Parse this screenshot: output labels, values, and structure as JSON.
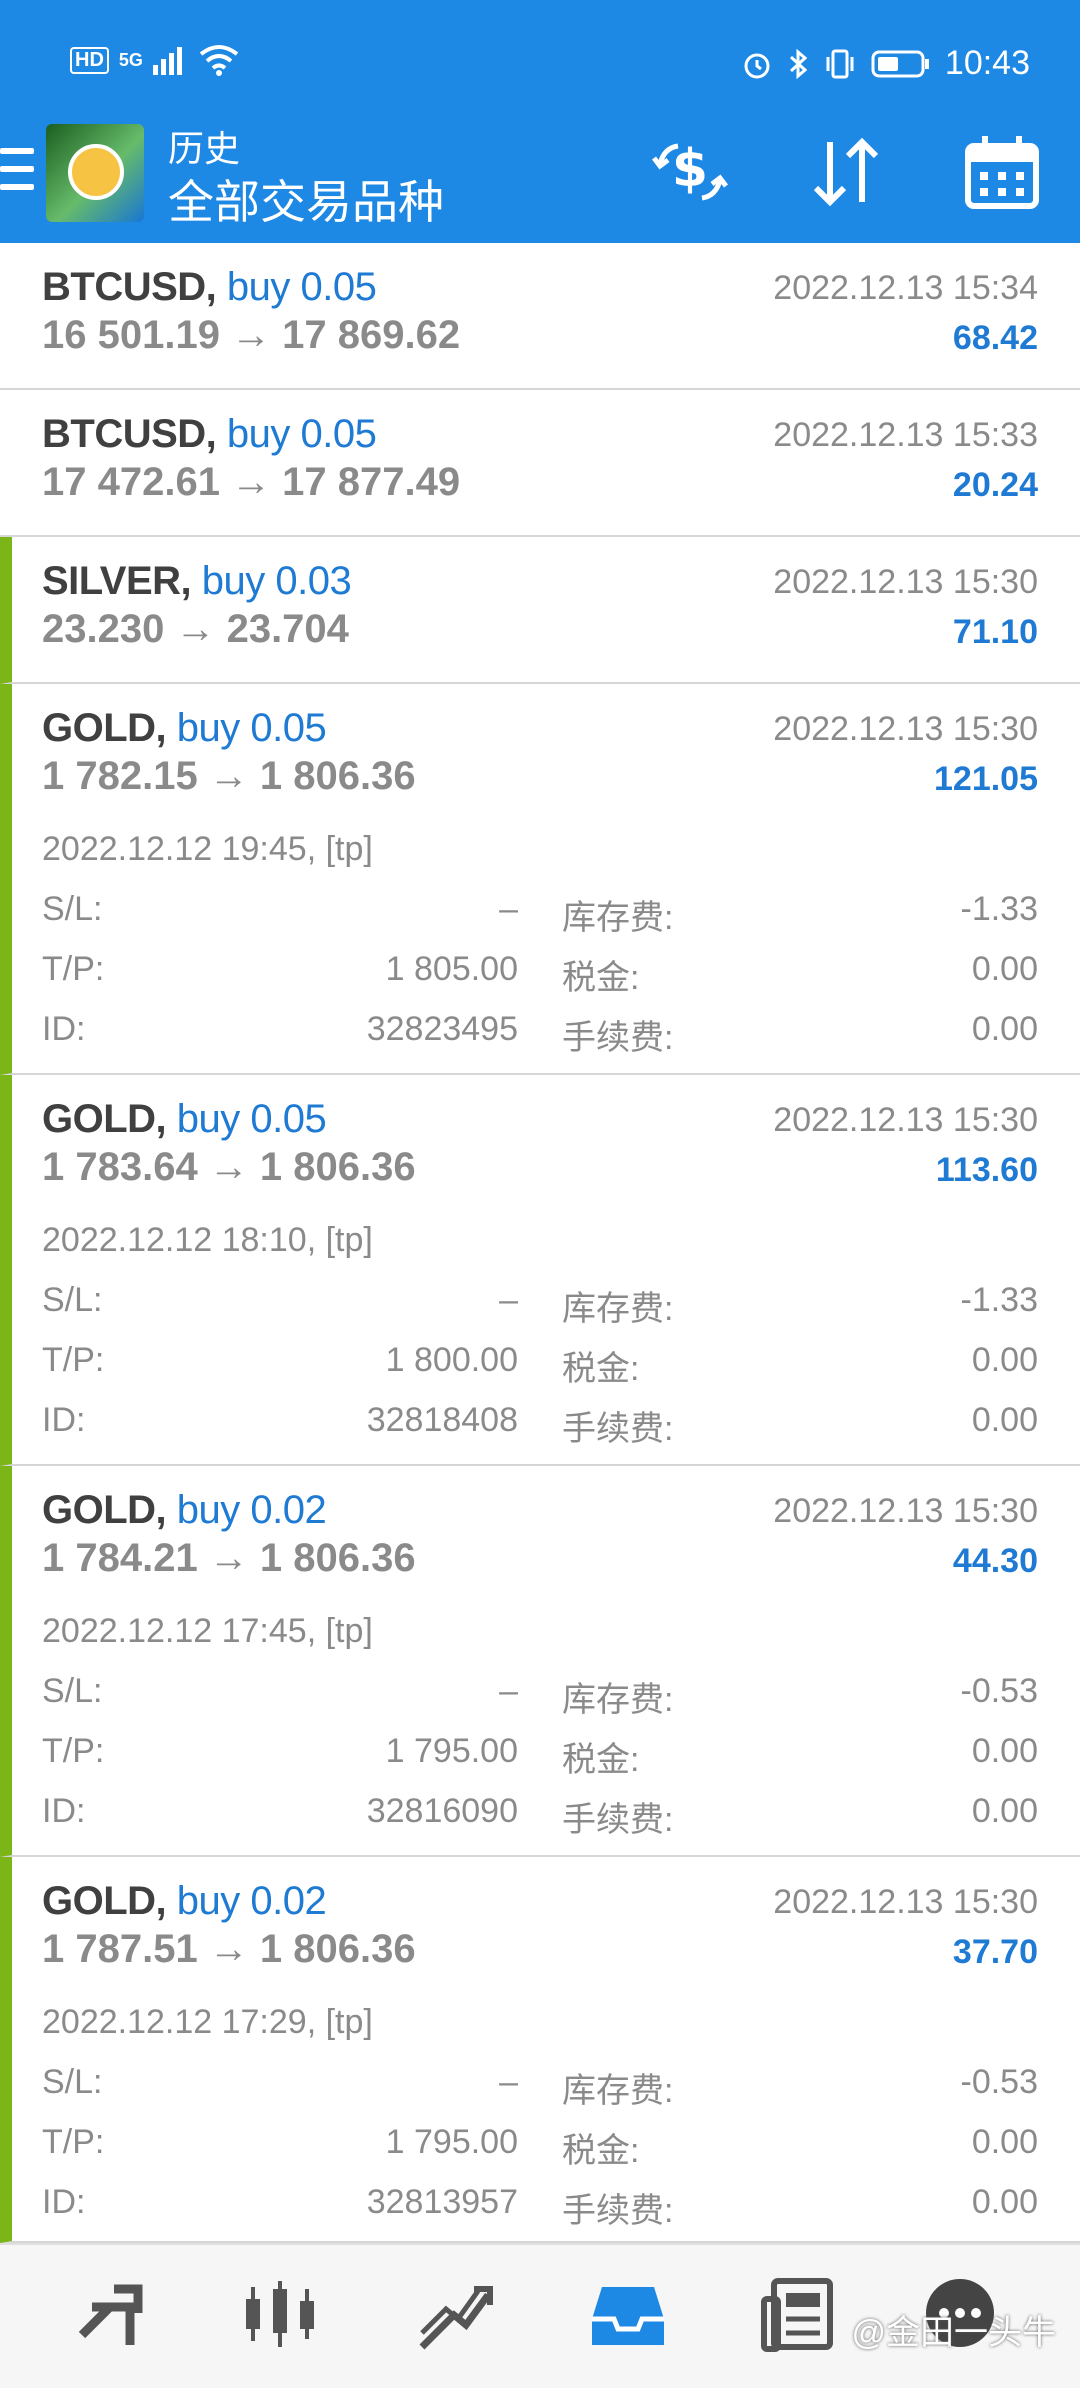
{
  "status": {
    "time": "10:43",
    "signal_hd": "HD",
    "signal_5g": "5G"
  },
  "header": {
    "subtitle": "历史",
    "title": "全部交易品种"
  },
  "trades": [
    {
      "symbol": "BTCUSD,",
      "side": "buy 0.05",
      "close_time": "2022.12.13 15:34",
      "prices": "16 501.19 → 17 869.62",
      "profit": "68.42",
      "green": false,
      "expanded": false
    },
    {
      "symbol": "BTCUSD,",
      "side": "buy 0.05",
      "close_time": "2022.12.13 15:33",
      "prices": "17 472.61 → 17 877.49",
      "profit": "20.24",
      "green": false,
      "expanded": false
    },
    {
      "symbol": "SILVER,",
      "side": "buy 0.03",
      "close_time": "2022.12.13 15:30",
      "prices": "23.230 → 23.704",
      "profit": "71.10",
      "green": true,
      "expanded": false
    },
    {
      "symbol": "GOLD,",
      "side": "buy 0.05",
      "close_time": "2022.12.13 15:30",
      "prices": "1 782.15 → 1 806.36",
      "profit": "121.05",
      "green": true,
      "expanded": true,
      "open_time": "2022.12.12 19:45, [tp]",
      "sl_label": "S/L:",
      "sl": "–",
      "tp_label": "T/P:",
      "tp": "1 805.00",
      "id_label": "ID:",
      "id": "32823495",
      "swap_label": "库存费:",
      "swap": "-1.33",
      "tax_label": "税金:",
      "tax": "0.00",
      "fee_label": "手续费:",
      "fee": "0.00"
    },
    {
      "symbol": "GOLD,",
      "side": "buy 0.05",
      "close_time": "2022.12.13 15:30",
      "prices": "1 783.64 → 1 806.36",
      "profit": "113.60",
      "green": true,
      "expanded": true,
      "open_time": "2022.12.12 18:10, [tp]",
      "sl_label": "S/L:",
      "sl": "–",
      "tp_label": "T/P:",
      "tp": "1 800.00",
      "id_label": "ID:",
      "id": "32818408",
      "swap_label": "库存费:",
      "swap": "-1.33",
      "tax_label": "税金:",
      "tax": "0.00",
      "fee_label": "手续费:",
      "fee": "0.00"
    },
    {
      "symbol": "GOLD,",
      "side": "buy 0.02",
      "close_time": "2022.12.13 15:30",
      "prices": "1 784.21 → 1 806.36",
      "profit": "44.30",
      "green": true,
      "expanded": true,
      "open_time": "2022.12.12 17:45, [tp]",
      "sl_label": "S/L:",
      "sl": "–",
      "tp_label": "T/P:",
      "tp": "1 795.00",
      "id_label": "ID:",
      "id": "32816090",
      "swap_label": "库存费:",
      "swap": "-0.53",
      "tax_label": "税金:",
      "tax": "0.00",
      "fee_label": "手续费:",
      "fee": "0.00"
    },
    {
      "symbol": "GOLD,",
      "side": "buy 0.02",
      "close_time": "2022.12.13 15:30",
      "prices": "1 787.51 → 1 806.36",
      "profit": "37.70",
      "green": true,
      "expanded": true,
      "open_time": "2022.12.12 17:29, [tp]",
      "sl_label": "S/L:",
      "sl": "–",
      "tp_label": "T/P:",
      "tp": "1 795.00",
      "id_label": "ID:",
      "id": "32813957",
      "swap_label": "库存费:",
      "swap": "-0.53",
      "tax_label": "税金:",
      "tax": "0.00",
      "fee_label": "手续费:",
      "fee": "0.00"
    }
  ],
  "bottom_nav": [
    {
      "icon": "quotes-icon"
    },
    {
      "icon": "chart-icon"
    },
    {
      "icon": "trade-icon"
    },
    {
      "icon": "history-icon",
      "active": true
    },
    {
      "icon": "news-icon"
    },
    {
      "icon": "messages-icon"
    }
  ],
  "watermark": "@金田一头牛",
  "colors": {
    "header": "#1e88e5",
    "accent": "#1e7ad3",
    "green_bar": "#7cb518",
    "active_nav": "#1e88e5"
  }
}
